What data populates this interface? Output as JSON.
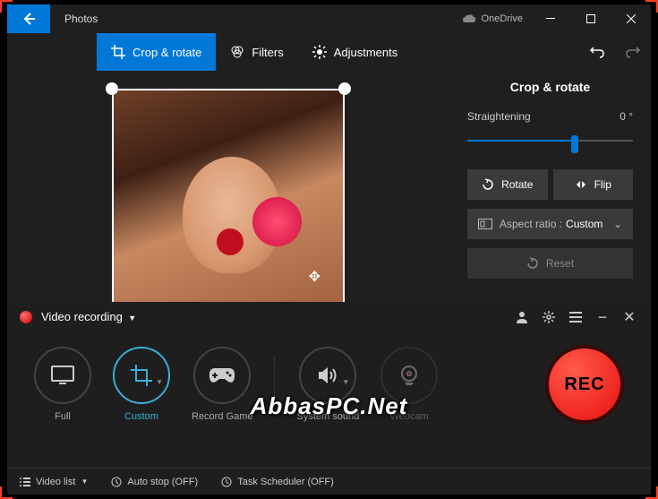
{
  "photos": {
    "app_title": "Photos",
    "onedrive": "OneDrive",
    "tabs": {
      "crop": "Crop & rotate",
      "filters": "Filters",
      "adjustments": "Adjustments"
    },
    "panel": {
      "title": "Crop & rotate",
      "straightening_label": "Straightening",
      "straightening_value": "0 °",
      "rotate": "Rotate",
      "flip": "Flip",
      "aspect_label": "Aspect ratio :",
      "aspect_value": "Custom",
      "reset": "Reset"
    }
  },
  "watermark": "AbbasPC.Net",
  "recorder": {
    "title": "Video recording",
    "modes": {
      "full": "Full",
      "custom": "Custom",
      "record_game": "Record Game",
      "system_sound": "System sound",
      "webcam": "Webcam"
    },
    "rec_label": "REC",
    "footer": {
      "video_list": "Video list",
      "auto_stop": "Auto stop (OFF)",
      "task_scheduler": "Task Scheduler (OFF)"
    }
  }
}
